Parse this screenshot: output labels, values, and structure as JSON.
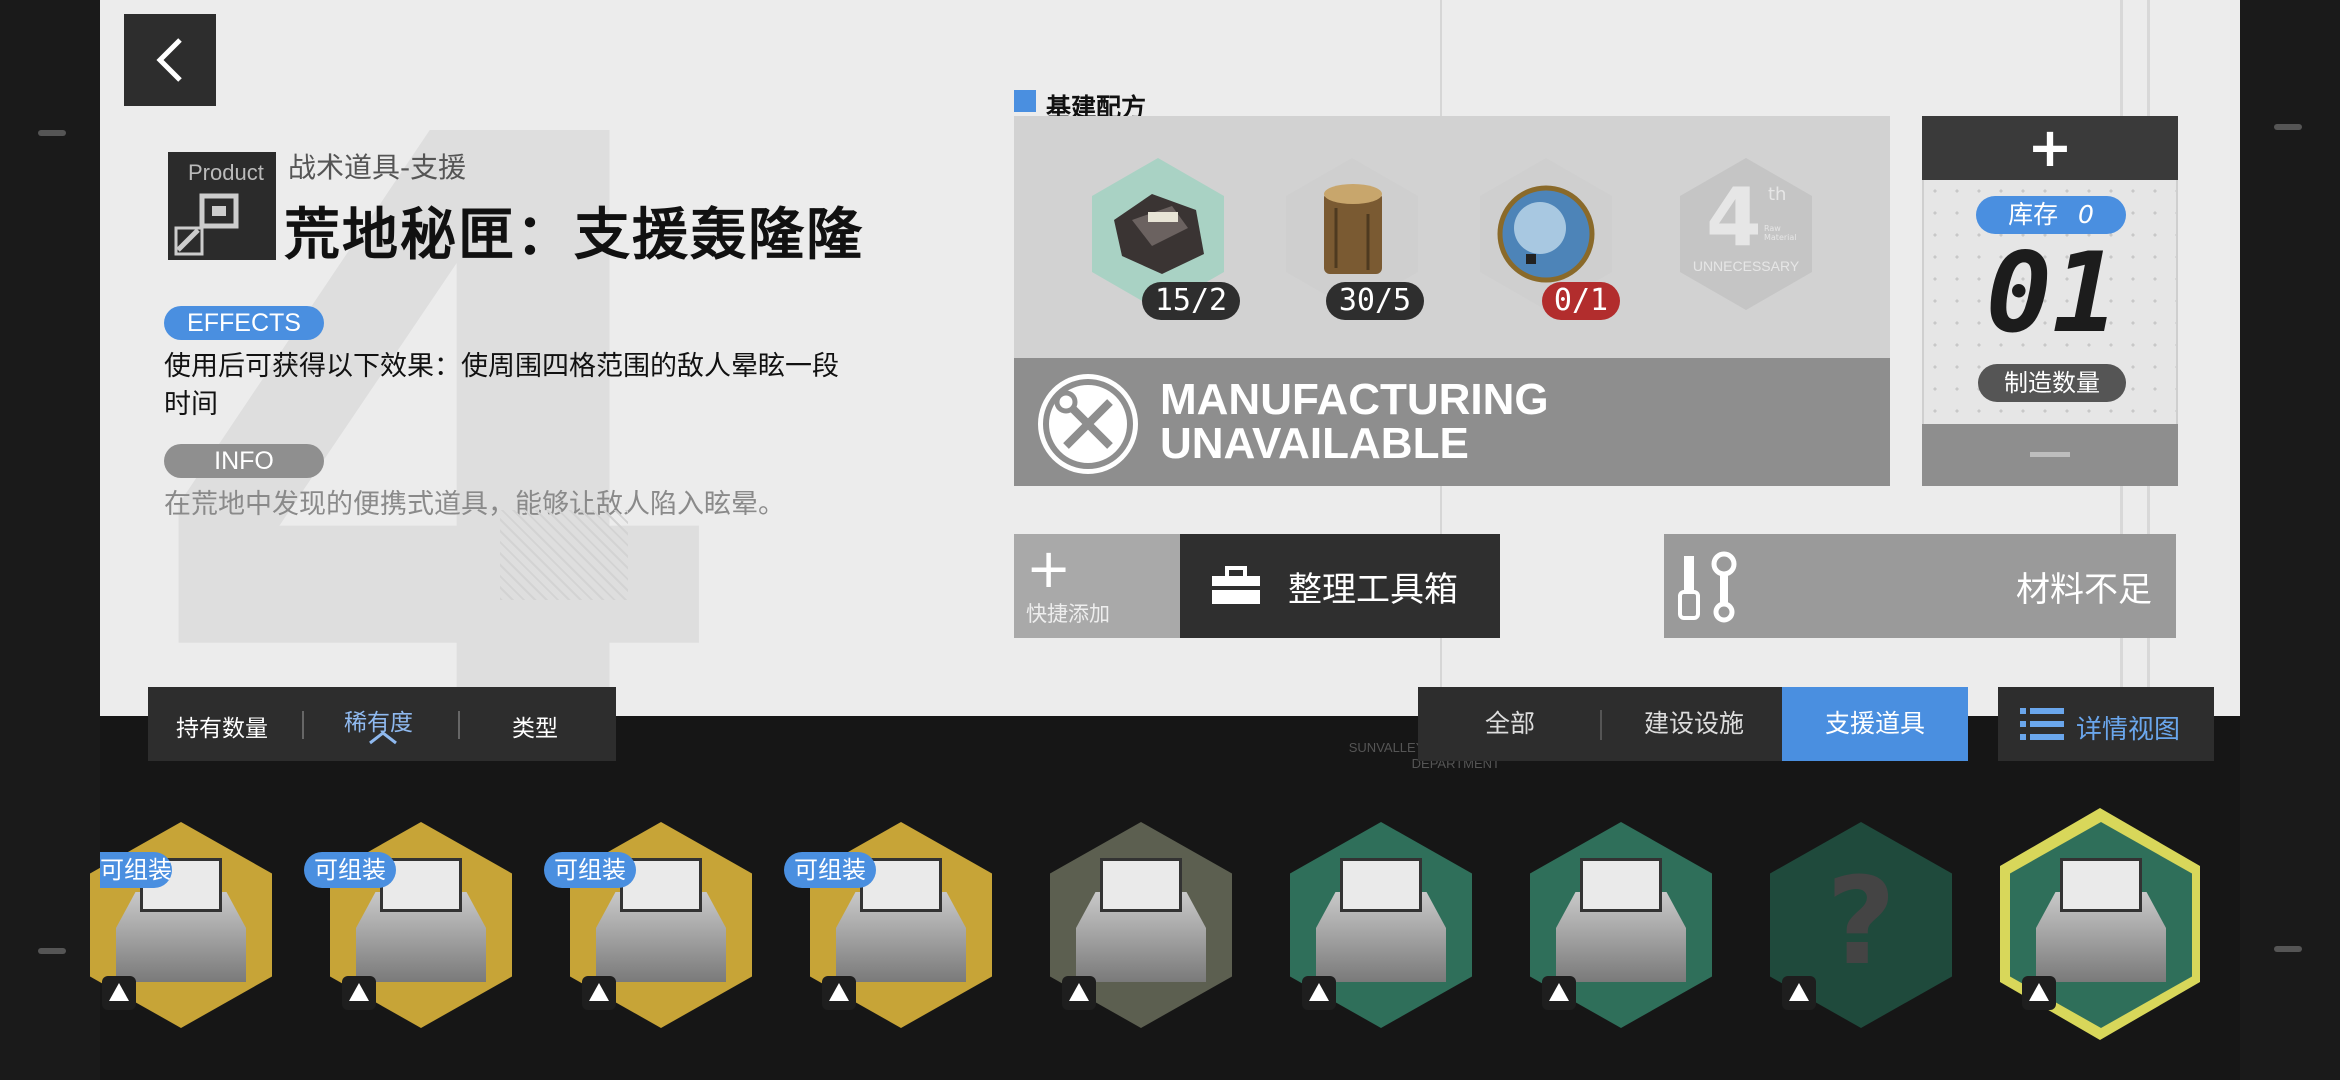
{
  "header": {
    "back_icon": "chevron-left-icon"
  },
  "item": {
    "product_badge": "Product",
    "category": "战术道具-支援",
    "title": "荒地秘匣：支援轰隆隆",
    "effects_label": "EFFECTS",
    "effects_text": "使用后可获得以下效果：使周围四格范围的敌人晕眩一段时间",
    "info_label": "INFO",
    "info_text": "在荒地中发现的便携式道具，能够让敌人陷入眩晕。"
  },
  "recipe": {
    "heading": "基建配方",
    "materials": [
      {
        "icon": "ore-icon",
        "count": "15/2",
        "insufficient": false
      },
      {
        "icon": "wood-log-icon",
        "count": "30/5",
        "insufficient": false
      },
      {
        "icon": "crystal-orb-icon",
        "count": "0/1",
        "insufficient": true
      },
      {
        "icon": "unnecessary-slot-icon",
        "count": "",
        "insufficient": false
      }
    ],
    "empty_slot": {
      "big": "4",
      "sup": "th",
      "small": "Raw Material",
      "label": "UNNECESSARY"
    }
  },
  "status": {
    "line1": "MANUFACTURING",
    "line2": "UNAVAILABLE",
    "icon": "wrench-screwdriver-icon"
  },
  "quantity": {
    "plus_label": "+",
    "stock_label": "库存",
    "stock_value": "0",
    "value": "01",
    "label": "制造数量"
  },
  "actions": {
    "quick_add_plus": "+",
    "quick_add_label": "快捷添加",
    "toolbox_label": "整理工具箱",
    "shortage_label": "材料不足"
  },
  "sort": {
    "items": [
      "持有数量",
      "稀有度",
      "类型"
    ],
    "active_index": 1
  },
  "filter": {
    "items": [
      "全部",
      "建设设施",
      "支援道具"
    ],
    "active_index": 2
  },
  "detail_view_label": "详情视图",
  "watermark": {
    "line1": "SUNVALLEY RESEARCH",
    "line2": "DEPARTMENT"
  },
  "tiles": [
    {
      "badge": "可组装",
      "color": "#c7a437"
    },
    {
      "badge": "可组装",
      "color": "#c7a437"
    },
    {
      "badge": "可组装",
      "color": "#c7a437"
    },
    {
      "badge": "可组装",
      "color": "#c7a437"
    },
    {
      "badge": "",
      "color": "#5c5f50"
    },
    {
      "badge": "",
      "color": "#2f6f5a"
    },
    {
      "badge": "",
      "color": "#2f6f5a"
    },
    {
      "badge": "",
      "color": "#1f4a3c",
      "unknown": true
    },
    {
      "badge": "",
      "color": "#2f6f5a",
      "selected": true
    }
  ],
  "unknown_glyph": "?",
  "colors": {
    "accent": "#4a8fe0",
    "warning": "#b22d2d",
    "selected": "#d8d75a"
  }
}
